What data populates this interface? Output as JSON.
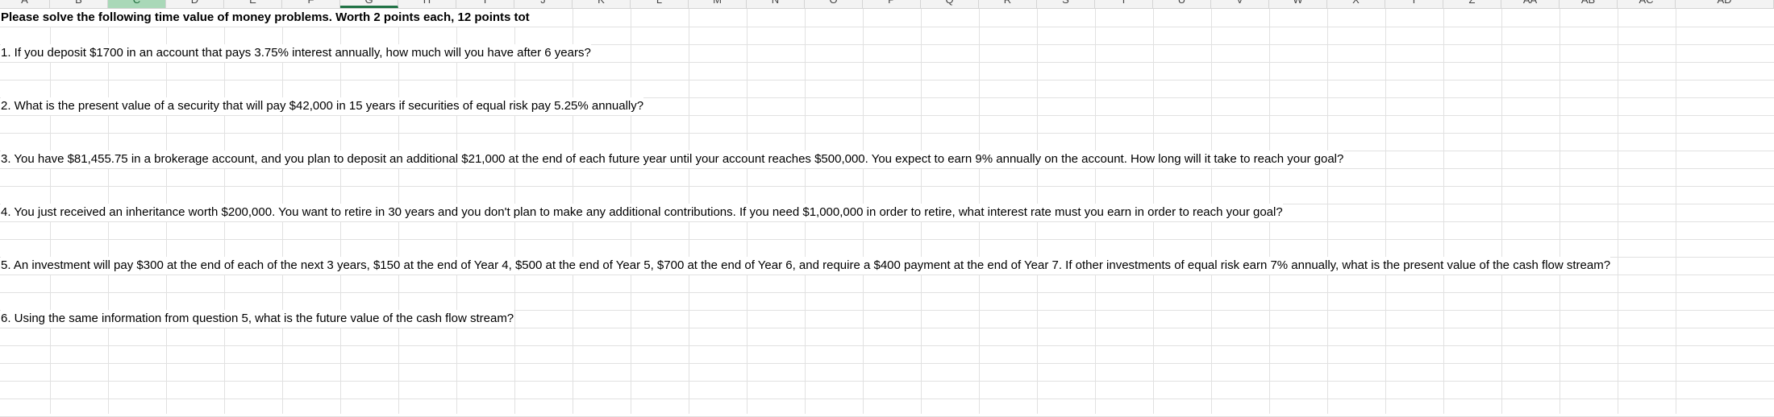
{
  "columns": [
    "A",
    "B",
    "C",
    "D",
    "E",
    "F",
    "G",
    "H",
    "I",
    "J",
    "K",
    "L",
    "M",
    "N",
    "O",
    "P",
    "Q",
    "R",
    "S",
    "T",
    "U",
    "V",
    "W",
    "X",
    "Y",
    "Z",
    "AA",
    "AB",
    "AC",
    "AD"
  ],
  "header_text": "Please solve the following time value of money problems. Worth 2 points each, 12 points tot",
  "questions": [
    "1. If you deposit $1700 in an account that pays 3.75% interest annually, how much will you have after 6 years?",
    "2. What is the present value of a security that will pay $42,000 in 15 years if securities of equal risk pay 5.25% annually?",
    "3. You have $81,455.75 in a brokerage account, and you plan to deposit an additional $21,000 at the end of each future year until your account reaches $500,000. You expect to earn 9% annually on the account. How long will it take to reach your goal?",
    "4. You just received an inheritance worth $200,000. You want to retire in 30 years and you don't plan to make any additional contributions. If you need $1,000,000 in order to retire, what interest rate must you earn in order to reach your goal?",
    "5. An investment will pay $300 at the end of each of the next 3 years, $150 at the end of Year 4, $500 at the end of Year 5, $700 at the end of Year 6, and require a $400 payment at the end of Year 7. If other investments of equal risk earn 7% annually, what is the present value of the cash flow stream?",
    "6. Using the same information from question 5, what is the future value of the cash flow stream?"
  ],
  "colors": {
    "selected_column_fill": "#a9d8b8",
    "active_column_border": "#217346",
    "gridline": "#e1e1e1"
  }
}
